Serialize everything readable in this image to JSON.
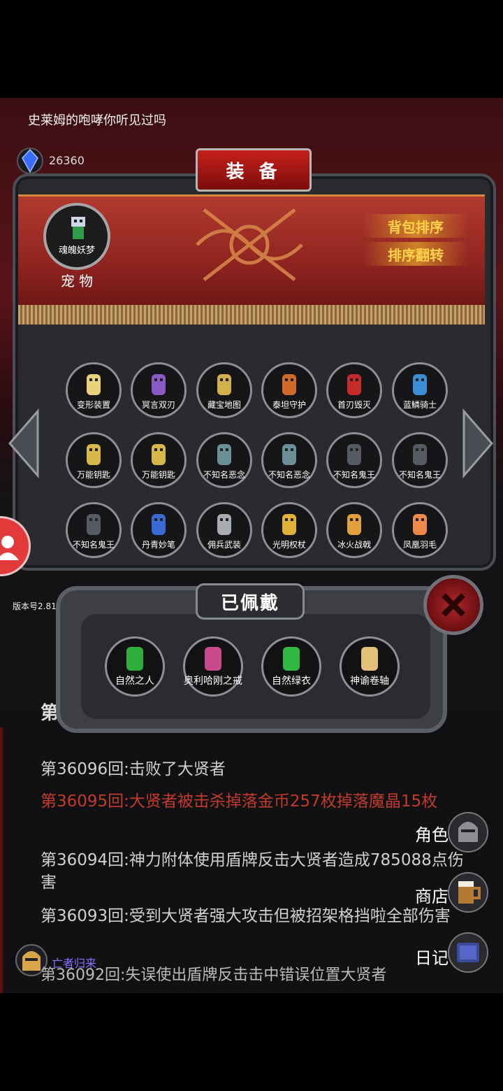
{
  "header": {
    "title": "史莱姆的咆哮你听见过吗",
    "gem_value": "26360"
  },
  "equip": {
    "title": "装 备",
    "pet": {
      "name": "魂魄妖梦",
      "label": "宠 物"
    },
    "sort_button": "背包排序",
    "reverse_button": "排序翻转",
    "items": [
      {
        "label": "变形装置",
        "icon": "skull-staff-icon"
      },
      {
        "label": "冥言双刃",
        "icon": "twin-blades-icon"
      },
      {
        "label": "藏宝地图",
        "icon": "treasure-map-icon"
      },
      {
        "label": "泰坦守护",
        "icon": "titan-armor-icon"
      },
      {
        "label": "首刃毁灭",
        "icon": "red-reaper-icon"
      },
      {
        "label": "蓝鳞骑士",
        "icon": "blue-knight-icon"
      },
      {
        "label": "万能钥匙",
        "icon": "key-icon"
      },
      {
        "label": "万能钥匙",
        "icon": "key-icon"
      },
      {
        "label": "不知名恶念",
        "icon": "ghost-icon"
      },
      {
        "label": "不知名恶念",
        "icon": "ghost-icon"
      },
      {
        "label": "不知名鬼王",
        "icon": "ghost-king-icon"
      },
      {
        "label": "不知名鬼王",
        "icon": "ghost-king-icon"
      },
      {
        "label": "不知名鬼王",
        "icon": "ghost-king-icon"
      },
      {
        "label": "丹青妙笔",
        "icon": "brush-icon"
      },
      {
        "label": "佣兵武装",
        "icon": "mercenary-armor-icon"
      },
      {
        "label": "光明权杖",
        "icon": "scepter-icon"
      },
      {
        "label": "冰火战戟",
        "icon": "halberd-icon"
      },
      {
        "label": "凤凰羽毛",
        "icon": "feather-icon"
      }
    ]
  },
  "version": "版本号2.81",
  "worn": {
    "title": "已佩戴",
    "items": [
      {
        "label": "自然之人",
        "icon": "nature-man-icon"
      },
      {
        "label": "奥利哈刚之戒",
        "icon": "ring-icon"
      },
      {
        "label": "自然绿衣",
        "icon": "green-robe-icon"
      },
      {
        "label": "神谕卷轴",
        "icon": "scroll-icon"
      }
    ]
  },
  "log": {
    "cut_prefix": "第",
    "lines": [
      {
        "text": "第36096回:击败了大贤者",
        "style": "normal"
      },
      {
        "text": "第36095回:大贤者被击杀掉落金币257枚掉落魔晶15枚",
        "style": "red"
      },
      {
        "text": "第36094回:神力附体使用盾牌反击大贤者造成785088点伤害",
        "style": "normal"
      },
      {
        "text": "第36093回:受到大贤者强大攻击但被招架格挡啦全部伤害",
        "style": "normal"
      }
    ],
    "cut_line": "第36092回:失误使出盾牌反击击中错误位置大贤者"
  },
  "side_menu": {
    "role": "角色",
    "shop": "商店",
    "diary": "日记"
  },
  "footer": {
    "player_name": "亡者归来"
  }
}
